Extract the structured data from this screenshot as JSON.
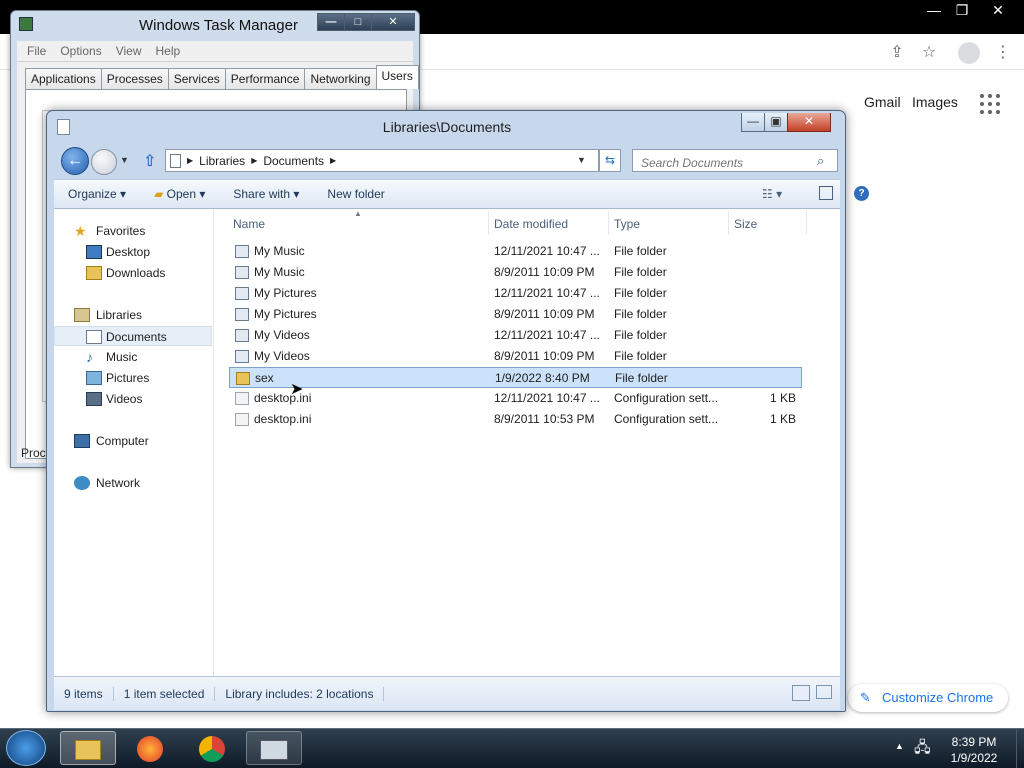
{
  "chrome": {
    "gmail": "Gmail",
    "images": "Images",
    "customize": "Customize Chrome"
  },
  "task_manager": {
    "title": "Windows Task Manager",
    "menu": [
      "File",
      "Options",
      "View",
      "Help"
    ],
    "tabs": [
      "Applications",
      "Processes",
      "Services",
      "Performance",
      "Networking",
      "Users"
    ],
    "active_tab": "Users",
    "footer_text": "Proce"
  },
  "explorer": {
    "title": "Libraries\\Documents",
    "breadcrumb": [
      "Libraries",
      "Documents"
    ],
    "search_placeholder": "Search Documents",
    "commands": [
      "Organize",
      "Open",
      "Share with",
      "New folder"
    ],
    "nav": {
      "favorites": "Favorites",
      "desktop": "Desktop",
      "downloads": "Downloads",
      "libraries": "Libraries",
      "documents": "Documents",
      "music": "Music",
      "pictures": "Pictures",
      "videos": "Videos",
      "computer": "Computer",
      "network": "Network"
    },
    "columns": [
      "Name",
      "Date modified",
      "Type",
      "Size"
    ],
    "files": [
      {
        "name": "My Music",
        "date": "12/11/2021 10:47 ...",
        "type": "File folder",
        "size": ""
      },
      {
        "name": "My Music",
        "date": "8/9/2011 10:09 PM",
        "type": "File folder",
        "size": ""
      },
      {
        "name": "My Pictures",
        "date": "12/11/2021 10:47 ...",
        "type": "File folder",
        "size": ""
      },
      {
        "name": "My Pictures",
        "date": "8/9/2011 10:09 PM",
        "type": "File folder",
        "size": ""
      },
      {
        "name": "My Videos",
        "date": "12/11/2021 10:47 ...",
        "type": "File folder",
        "size": ""
      },
      {
        "name": "My Videos",
        "date": "8/9/2011 10:09 PM",
        "type": "File folder",
        "size": ""
      },
      {
        "name": "sex",
        "date": "1/9/2022 8:40 PM",
        "type": "File folder",
        "size": ""
      },
      {
        "name": "desktop.ini",
        "date": "12/11/2021 10:47 ...",
        "type": "Configuration sett...",
        "size": "1 KB"
      },
      {
        "name": "desktop.ini",
        "date": "8/9/2011 10:53 PM",
        "type": "Configuration sett...",
        "size": "1 KB"
      }
    ],
    "status": {
      "count": "9 items",
      "selected": "1 item selected",
      "library": "Library includes: 2 locations"
    }
  },
  "taskbar": {
    "time": "8:39 PM",
    "date": "1/9/2022"
  }
}
